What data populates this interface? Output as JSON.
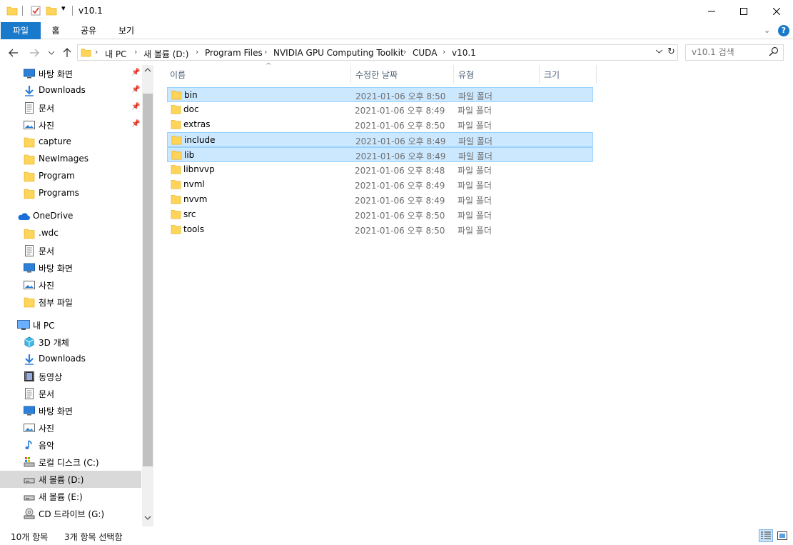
{
  "window": {
    "title": "v10.1",
    "quick_access_dropdown": "▾"
  },
  "ribbon": {
    "tabs": [
      "파일",
      "홈",
      "공유",
      "보기"
    ],
    "expand_glyph": "⌄",
    "help": "?"
  },
  "address": {
    "breadcrumbs": [
      "내 PC",
      "새 볼륨 (D:)",
      "Program Files",
      "NVIDIA GPU Computing Toolkit",
      "CUDA",
      "v10.1"
    ],
    "search_placeholder": "v10.1 검색"
  },
  "nav": {
    "quick_access": [
      {
        "label": "바탕 화면",
        "icon": "desktop-icon",
        "pinned": true
      },
      {
        "label": "Downloads",
        "icon": "download-icon",
        "pinned": true
      },
      {
        "label": "문서",
        "icon": "document-icon",
        "pinned": true
      },
      {
        "label": "사진",
        "icon": "picture-icon",
        "pinned": true
      },
      {
        "label": "capture",
        "icon": "folder-icon"
      },
      {
        "label": "NewImages",
        "icon": "folder-icon"
      },
      {
        "label": "Program",
        "icon": "folder-icon"
      },
      {
        "label": "Programs",
        "icon": "folder-icon"
      }
    ],
    "onedrive": {
      "label": "OneDrive",
      "items": [
        {
          "label": ".wdc",
          "icon": "folder-icon"
        },
        {
          "label": "문서",
          "icon": "document-icon"
        },
        {
          "label": "바탕 화면",
          "icon": "desktop-icon"
        },
        {
          "label": "사진",
          "icon": "picture-icon"
        },
        {
          "label": "첨부 파일",
          "icon": "folder-icon"
        }
      ]
    },
    "this_pc": {
      "label": "내 PC",
      "items": [
        {
          "label": "3D 개체",
          "icon": "cube-3d-icon"
        },
        {
          "label": "Downloads",
          "icon": "download-icon"
        },
        {
          "label": "동영상",
          "icon": "video-icon"
        },
        {
          "label": "문서",
          "icon": "document-icon"
        },
        {
          "label": "바탕 화면",
          "icon": "desktop-icon"
        },
        {
          "label": "사진",
          "icon": "picture-icon"
        },
        {
          "label": "음악",
          "icon": "music-icon"
        },
        {
          "label": "로컬 디스크 (C:)",
          "icon": "system-drive-icon"
        },
        {
          "label": "새 볼륨 (D:)",
          "icon": "drive-icon",
          "selected": true
        },
        {
          "label": "새 볼륨 (E:)",
          "icon": "drive-icon"
        },
        {
          "label": "CD 드라이브 (G:)",
          "icon": "cd-drive-icon"
        }
      ]
    }
  },
  "list": {
    "columns": [
      "이름",
      "수정한 날짜",
      "유형",
      "크기"
    ],
    "sort_indicator": "^",
    "rows": [
      {
        "name": "bin",
        "date": "2021-01-06 오후 8:50",
        "type": "파일 폴더",
        "selected": true
      },
      {
        "name": "doc",
        "date": "2021-01-06 오후 8:49",
        "type": "파일 폴더"
      },
      {
        "name": "extras",
        "date": "2021-01-06 오후 8:50",
        "type": "파일 폴더"
      },
      {
        "name": "include",
        "date": "2021-01-06 오후 8:49",
        "type": "파일 폴더",
        "selected": true
      },
      {
        "name": "lib",
        "date": "2021-01-06 오후 8:49",
        "type": "파일 폴더",
        "selected": true
      },
      {
        "name": "libnvvp",
        "date": "2021-01-06 오후 8:48",
        "type": "파일 폴더"
      },
      {
        "name": "nvml",
        "date": "2021-01-06 오후 8:49",
        "type": "파일 폴더"
      },
      {
        "name": "nvvm",
        "date": "2021-01-06 오후 8:49",
        "type": "파일 폴더"
      },
      {
        "name": "src",
        "date": "2021-01-06 오후 8:50",
        "type": "파일 폴더"
      },
      {
        "name": "tools",
        "date": "2021-01-06 오후 8:50",
        "type": "파일 폴더"
      }
    ]
  },
  "status": {
    "item_count": "10개 항목",
    "selected_count": "3개 항목 선택함"
  },
  "colors": {
    "accent": "#1979ca",
    "selection": "#cce8ff",
    "selection_border": "#99d1ff",
    "folder": "#ffd45b"
  }
}
